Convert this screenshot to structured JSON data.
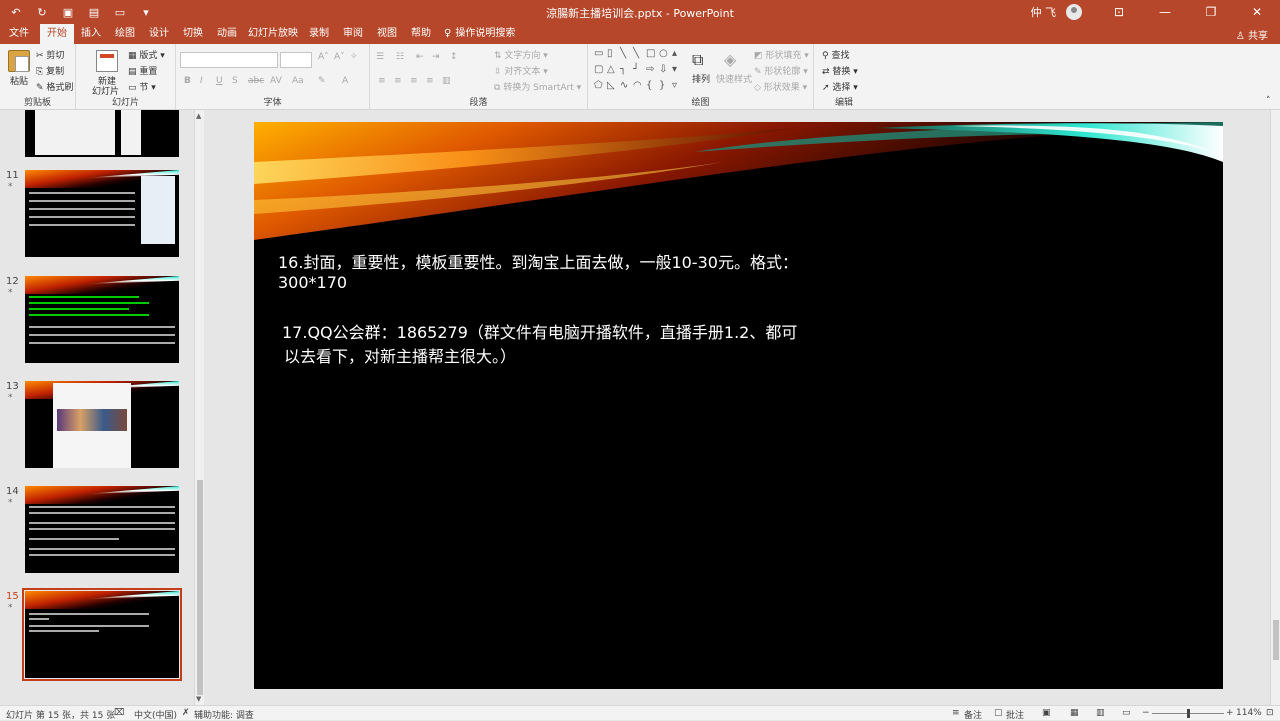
{
  "app": {
    "window_title": "涼腸新主播培训会.pptx  -  PowerPoint",
    "user_name": "仲 飞",
    "share_label": "共享"
  },
  "tabs": [
    {
      "label": "文件",
      "active": false
    },
    {
      "label": "开始",
      "active": true
    },
    {
      "label": "插入",
      "active": false
    },
    {
      "label": "绘图",
      "active": false
    },
    {
      "label": "设计",
      "active": false
    },
    {
      "label": "切换",
      "active": false
    },
    {
      "label": "动画",
      "active": false
    },
    {
      "label": "幻灯片放映",
      "active": false
    },
    {
      "label": "录制",
      "active": false
    },
    {
      "label": "审阅",
      "active": false
    },
    {
      "label": "视图",
      "active": false
    },
    {
      "label": "帮助",
      "active": false
    }
  ],
  "tell_me": "操作说明搜索",
  "ribbon": {
    "clipboard": {
      "label": "剪贴板",
      "paste": "粘贴",
      "cut": "剪切",
      "copy": "复制",
      "format_painter": "格式刷"
    },
    "slides": {
      "label": "幻灯片",
      "new_slide": "新建",
      "new_slide_2": "幻灯片",
      "layout": "版式",
      "reset": "重置",
      "section": "节"
    },
    "font": {
      "label": "字体"
    },
    "paragraph": {
      "label": "段落",
      "text_direction": "文字方向",
      "align_text": "对齐文本",
      "smartart": "转换为 SmartArt"
    },
    "drawing": {
      "label": "绘图",
      "arrange": "排列",
      "quick_styles": "快速样式",
      "shape_fill": "形状填充",
      "shape_outline": "形状轮廓",
      "shape_effects": "形状效果"
    },
    "editing": {
      "label": "编辑",
      "find": "查找",
      "replace": "替换",
      "select": "选择"
    }
  },
  "thumbnails": [
    {
      "number": "",
      "star": ""
    },
    {
      "number": "11",
      "star": "*"
    },
    {
      "number": "12",
      "star": "*"
    },
    {
      "number": "13",
      "star": "*"
    },
    {
      "number": "14",
      "star": "*"
    },
    {
      "number": "15",
      "star": "*"
    }
  ],
  "slide": {
    "line1": "16.封面，重要性，模板重要性。到淘宝上面去做，一般10-30元。格式：",
    "line2": "300*170",
    "line3": "17.QQ公会群：1865279（群文件有电脑开播软件，直播手册1.2、都可",
    "line4": "以去看下，对新主播帮主很大。）"
  },
  "status": {
    "slide_counter": "幻灯片 第 15 张，共 15 张",
    "language": "中文(中国)",
    "accessibility": "辅助功能: 调查",
    "notes": "备注",
    "comments": "批注",
    "zoom": "114%"
  },
  "colors": {
    "accent": "#b7472a",
    "selected_thumb": "#c43e1c"
  }
}
